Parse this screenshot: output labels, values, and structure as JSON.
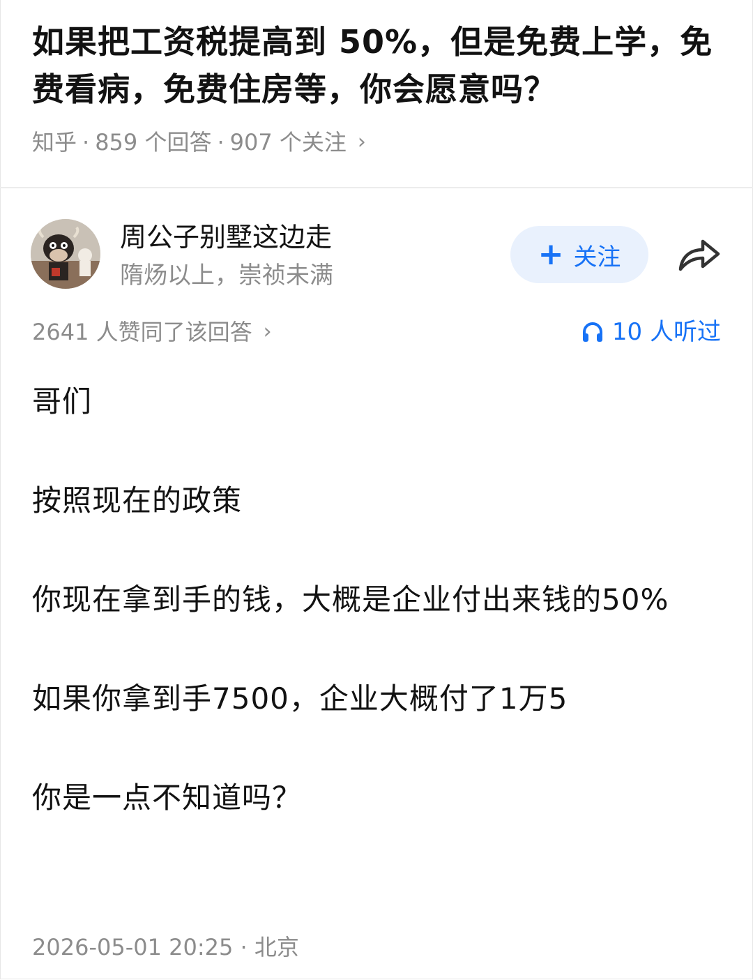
{
  "question": {
    "title": "如果把工资税提高到 50%，但是免费上学，免费看病，免费住房等，你会愿意吗？",
    "source": "知乎",
    "answers": "859 个回答",
    "followers": "907 个关注",
    "separator": "·",
    "chevron": "›"
  },
  "author": {
    "name": "周公子别墅这边走",
    "bio": "隋炀以上，崇祯未满",
    "avatar_icon": "cartoon-cow-avatar",
    "follow_label": "关注",
    "follow_icon": "plus-icon",
    "share_icon": "share-arrow-icon"
  },
  "stats": {
    "votes": "2641 人赞同了该回答",
    "votes_chevron": "›",
    "listeners": "10 人听过",
    "listeners_icon": "headphones-icon"
  },
  "answer": {
    "paragraphs": [
      "哥们",
      "按照现在的政策",
      "你现在拿到手的钱，大概是企业付出来钱的50%",
      "如果你拿到手7500，企业大概付了1万5",
      "你是一点不知道吗？"
    ]
  },
  "footer": {
    "timestamp": "2026-05-01 20:25 · 北京"
  },
  "colors": {
    "accent": "#1772f6",
    "follow_bg": "#e9f1fd",
    "muted_text": "#8c8c8c",
    "primary_text": "#121212"
  }
}
